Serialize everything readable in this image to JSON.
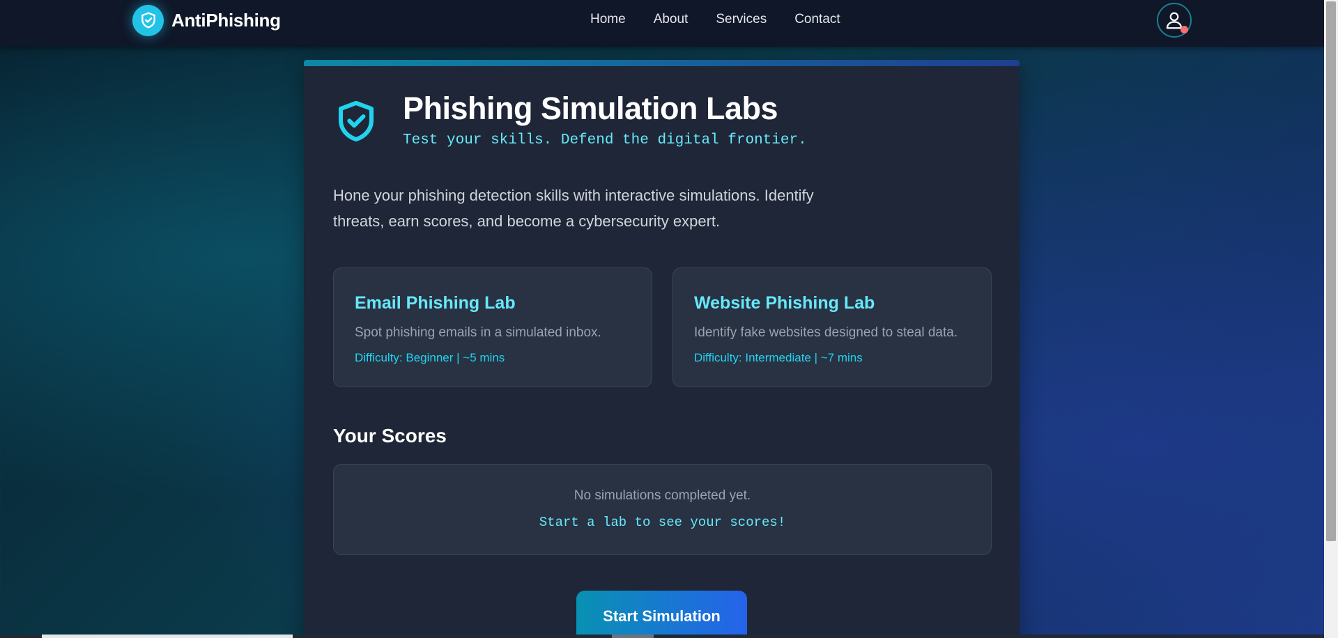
{
  "nav": {
    "brand": "AntiPhishing",
    "links": [
      "Home",
      "About",
      "Services",
      "Contact"
    ],
    "brand_icon": "shield-check-icon",
    "profile_icon": "user-icon"
  },
  "hero": {
    "title": "Phishing Simulation Labs",
    "subtitle": "Test your skills. Defend the digital frontier.",
    "icon": "shield-check-icon"
  },
  "intro": "Hone your phishing detection skills with interactive simulations. Identify threats, earn scores, and become a cybersecurity expert.",
  "labs": [
    {
      "title": "Email Phishing Lab",
      "description": "Spot phishing emails in a simulated inbox.",
      "meta": "Difficulty: Beginner | ~5 mins"
    },
    {
      "title": "Website Phishing Lab",
      "description": "Identify fake websites designed to steal data.",
      "meta": "Difficulty: Intermediate | ~7 mins"
    }
  ],
  "scores": {
    "heading": "Your Scores",
    "empty_text": "No simulations completed yet.",
    "hint": "Start a lab to see your scores!"
  },
  "start_button": "Start Simulation",
  "colors": {
    "accent": "#22d3ee",
    "accent_light": "#67e8f9",
    "card_bg": "#1e2637",
    "nav_bg": "#0f1728",
    "notification_dot": "#f87171"
  }
}
